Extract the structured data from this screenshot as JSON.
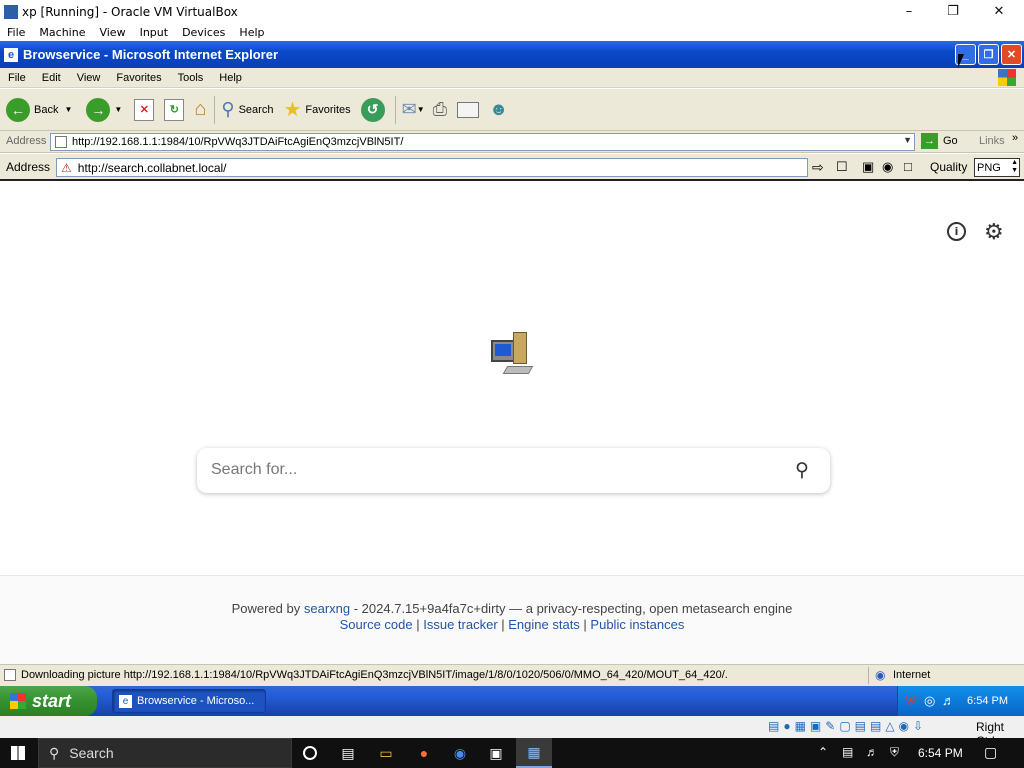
{
  "host_window": {
    "title": "xp [Running] - Oracle VM VirtualBox",
    "menu": [
      "File",
      "Machine",
      "View",
      "Input",
      "Devices",
      "Help"
    ]
  },
  "ie": {
    "title": "Browservice - Microsoft Internet Explorer",
    "menu": [
      "File",
      "Edit",
      "View",
      "Favorites",
      "Tools",
      "Help"
    ],
    "toolbar": {
      "back": "Back",
      "search": "Search",
      "favorites": "Favorites"
    },
    "address_label": "Address",
    "address_url": "http://192.168.1.1:1984/10/RpVWq3JTDAiFtcAgiEnQ3mzcjVBlN5IT/",
    "go_label": "Go",
    "links_label": "Links",
    "status_text": "Downloading picture http://192.168.1.1:1984/10/RpVWq3JTDAiFtcAgiEnQ3mzcjVBlN5IT/image/1/8/0/1020/506/0/MMO_64_420/MOUT_64_420/.",
    "zone": "Internet"
  },
  "browservice": {
    "address_label": "Address",
    "url": "http://search.collabnet.local/",
    "quality_label": "Quality",
    "quality_value": "PNG"
  },
  "page": {
    "search_placeholder": "Search for...",
    "footer_powered": "Powered by",
    "footer_link": "searxng",
    "footer_version": " - 2024.7.15+9a4fa7c+dirty — a privacy-respecting, open metasearch engine",
    "footer_links": [
      "Source code",
      "Issue tracker",
      "Engine stats",
      "Public instances"
    ]
  },
  "xp_taskbar": {
    "start_label": "start",
    "task_label": "Browservice - Microso...",
    "clock": "6:54 PM"
  },
  "vb_status": {
    "host_key": "Right Ctrl"
  },
  "win10_taskbar": {
    "search_label": "Search",
    "clock": "6:54 PM"
  }
}
